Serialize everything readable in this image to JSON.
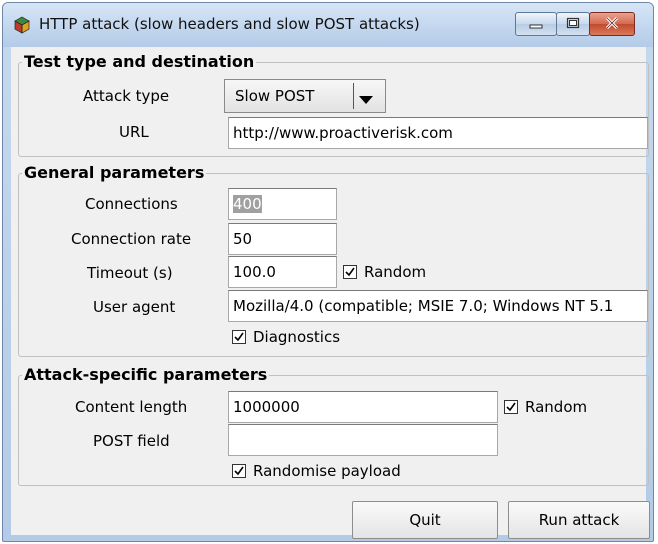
{
  "window": {
    "title": "HTTP attack (slow headers and slow POST attacks)",
    "icon": "app-cube-icon",
    "controls": {
      "minimize": "minimize-icon",
      "maximize": "maximize-icon",
      "close": "close-icon"
    }
  },
  "test_type": {
    "legend": "Test type and destination",
    "attack_type_label": "Attack type",
    "attack_type_value": "Slow POST",
    "url_label": "URL",
    "url_value": "http://www.proactiverisk.com"
  },
  "general": {
    "legend": "General parameters",
    "connections_label": "Connections",
    "connections_value": "400",
    "connection_rate_label": "Connection rate",
    "connection_rate_value": "50",
    "timeout_label": "Timeout (s)",
    "timeout_value": "100.0",
    "timeout_random_label": "Random",
    "timeout_random_checked": true,
    "user_agent_label": "User agent",
    "user_agent_value": "Mozilla/4.0 (compatible; MSIE 7.0; Windows NT 5.1",
    "diagnostics_label": "Diagnostics",
    "diagnostics_checked": true
  },
  "attack_specific": {
    "legend": "Attack-specific parameters",
    "content_length_label": "Content length",
    "content_length_value": "1000000",
    "content_length_random_label": "Random",
    "content_length_random_checked": true,
    "post_field_label": "POST field",
    "post_field_value": "",
    "randomise_payload_label": "Randomise payload",
    "randomise_payload_checked": true
  },
  "buttons": {
    "quit": "Quit",
    "run_attack": "Run attack"
  }
}
